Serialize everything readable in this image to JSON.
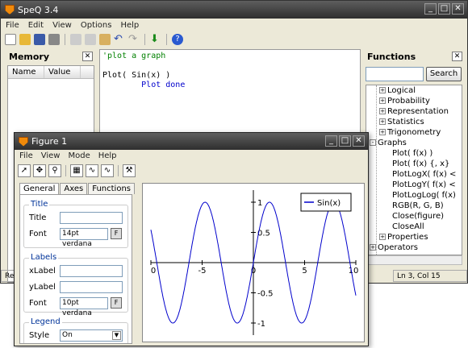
{
  "app": {
    "title": "SpeQ 3.4",
    "menu": [
      "File",
      "Edit",
      "View",
      "Options",
      "Help"
    ]
  },
  "memory": {
    "title": "Memory",
    "columns": [
      "Name",
      "Value"
    ]
  },
  "editor": {
    "lines": [
      {
        "text": "'plot a graph",
        "color": "#008000"
      },
      {
        "text": "",
        "color": "#000"
      },
      {
        "text": "Plot( Sin(x) )",
        "color": "#000"
      },
      {
        "text": "        Plot done",
        "color": "#0000cc"
      }
    ]
  },
  "functions": {
    "title": "Functions",
    "search_button": "Search",
    "items": [
      {
        "label": "Logical",
        "depth": 1,
        "toggle": "+"
      },
      {
        "label": "Probability",
        "depth": 1,
        "toggle": "+"
      },
      {
        "label": "Representation",
        "depth": 1,
        "toggle": "+"
      },
      {
        "label": "Statistics",
        "depth": 1,
        "toggle": "+"
      },
      {
        "label": "Trigonometry",
        "depth": 1,
        "toggle": "+"
      },
      {
        "label": "Graphs",
        "depth": 0,
        "toggle": "-"
      },
      {
        "label": "Plot( f(x) )",
        "depth": 2,
        "toggle": ""
      },
      {
        "label": "Plot( f(x) {, x}",
        "depth": 2,
        "toggle": ""
      },
      {
        "label": "PlotLogX( f(x) <",
        "depth": 2,
        "toggle": ""
      },
      {
        "label": "PlotLogY( f(x) <",
        "depth": 2,
        "toggle": ""
      },
      {
        "label": "PlotLogLog( f(x)",
        "depth": 2,
        "toggle": ""
      },
      {
        "label": "RGB(R, G, B)",
        "depth": 2,
        "toggle": ""
      },
      {
        "label": "Close(figure)",
        "depth": 2,
        "toggle": ""
      },
      {
        "label": "CloseAll",
        "depth": 2,
        "toggle": ""
      },
      {
        "label": "Properties",
        "depth": 1,
        "toggle": "+"
      },
      {
        "label": "Operators",
        "depth": 0,
        "toggle": "+"
      }
    ]
  },
  "status": {
    "left": "Rea",
    "right": "Ln 3, Col 15"
  },
  "figure": {
    "title": "Figure 1",
    "menu": [
      "File",
      "View",
      "Mode",
      "Help"
    ],
    "tabs": [
      "General",
      "Axes",
      "Functions"
    ],
    "title_group": {
      "heading": "Title",
      "title_label": "Title",
      "title_value": "",
      "font_label": "Font",
      "font_value": "14pt verdana",
      "font_button": "F"
    },
    "labels_group": {
      "heading": "Labels",
      "xlabel": "xLabel",
      "ylabel": "yLabel",
      "font_label": "Font",
      "font_value": "10pt verdana",
      "font_button": "F"
    },
    "legend_group": {
      "heading": "Legend",
      "style_label": "Style",
      "style_value": "On"
    }
  },
  "chart_data": {
    "type": "line",
    "title": "",
    "xlabel": "",
    "ylabel": "",
    "xlim": [
      -10,
      10
    ],
    "ylim": [
      -1.2,
      1.2
    ],
    "xticks": [
      -10,
      -5,
      0,
      5,
      10
    ],
    "xtick_labels": [
      "0",
      "-5",
      "0",
      "5",
      "10"
    ],
    "yticks": [
      -1,
      -0.5,
      0,
      0.5,
      1
    ],
    "ytick_labels": [
      "-1",
      "-0.5",
      "0",
      "0.5",
      "1"
    ],
    "series": [
      {
        "name": "Sin(x)",
        "function": "sin(x)",
        "color": "#0000cc"
      }
    ],
    "legend": "top-right",
    "grid": false
  }
}
